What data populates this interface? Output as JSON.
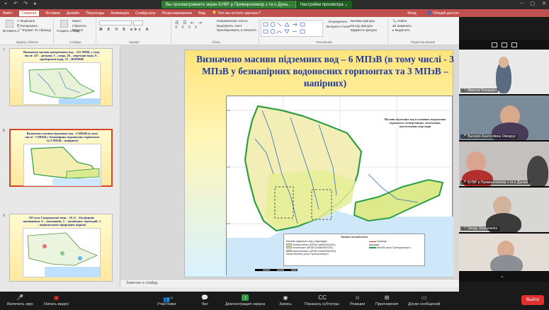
{
  "titlebar": {
    "share_message": "Вы просматриваете экран БУВР р.Приморономор з та є-Дуна...",
    "view_options": "Настройки просмотра"
  },
  "ribbon": {
    "tabs": [
      "Файл",
      "Главная",
      "Вставка",
      "Дизайн",
      "Переходы",
      "Анимация",
      "Слайд-шоу",
      "Рецензирование",
      "Вид",
      "Что вы хотите сделать?"
    ],
    "right": [
      "Вход",
      "Общий доступ"
    ],
    "clipboard": {
      "paste": "Вставить",
      "cut": "Вырезать",
      "copy": "Копировать",
      "format_painter": "Формат по образцу",
      "group": "Буфер обмена"
    },
    "slides": {
      "new_slide": "Создать слайд",
      "layout": "Макет",
      "reset": "Сбросить",
      "section": "Раздел",
      "group": "Слайды"
    },
    "font_group": "Шрифт",
    "paragraph": {
      "text_direction": "Направление текста",
      "align_text": "Выровнять текст",
      "smartart": "Преобразовать в SmartArt",
      "group": "Абзац"
    },
    "drawing": {
      "arrange": "Упорядочить",
      "quick_styles": "Экспресс-стили",
      "fill": "Заливка фигуры",
      "outline": "Контур фигуры",
      "effects": "Эффекты фигуры",
      "group": "Рисование"
    },
    "editing": {
      "find": "Найти",
      "replace": "Заменить",
      "select": "Выделить",
      "group": "Редактирование"
    }
  },
  "thumbnails": [
    {
      "num": "7",
      "title": "Визначено масиви поверхневих вод – 231 МПВ, у тому числі: 227 – річкові, 3 – озера, 28 – перехідні води, 9 – прибережні води, 72 – ШЗМПВ"
    },
    {
      "num": "8",
      "title": "Визначено масиви підземних вод – 6 МПзВ (в тому числі - 3 МПзВ у безнапірних водоносних горизонтах та 3 МПзВ – напірних)"
    },
    {
      "num": "9",
      "title": "Об'єкти Спорадичної зони – 16 (2 – біосферних заповідника, 6 – заказників, 5 – заповідних територій, 3 – національних природних парків)"
    }
  ],
  "slide": {
    "title": "Визначено масиви підземних вод – 6 МПзВ (в тому числі - 3 МПзВ у безнапірних водоносних горизонтах та 3 МПзВ – напірних)",
    "map_title": "Масиви підземних вод в основних водоносних горизонтах четвертинних, неогенових, палеогенових відкладів",
    "legend": {
      "heading": "Умовні позначення",
      "items": [
        "Масиви підземних вод у відкладах:",
        "четвертинних (МПзВ UA6M9000400)",
        "неогенових (МПзВ UA6M9000200)",
        "палеогенових (МПзВ UA6M9000300)",
        "Межа басейну річок Причорномор'я",
        "Границя",
        "держави",
        "басейн річок Причорномор'я"
      ]
    }
  },
  "notes": {
    "placeholder": "Заметки к слайду"
  },
  "participants": [
    {
      "name": "Микола Бомашин",
      "muted": true
    },
    {
      "name": "Валерія Анатоліївна Овчарук",
      "muted": true
    },
    {
      "name": "БУВР р.Приморономор з та є-Дунаю",
      "muted": true
    },
    {
      "name": "Sergiy Stepanenko",
      "muted": true
    },
    {
      "name": "",
      "muted": false
    }
  ],
  "zoom_toolbar": {
    "mute": "Включить звук",
    "video": "Начать видео",
    "participants": "Участники",
    "participants_count": "11",
    "chat": "Чат",
    "share": "Демонстрация экрана",
    "record": "Запись",
    "captions": "Показать субтитры",
    "reactions": "Реакции",
    "apps": "Приложения",
    "whiteboards": "Доски сообщений",
    "leave": "Выйти"
  },
  "colors": {
    "ribbon": "#c0504d",
    "slide_title": "#1f3aa0",
    "share_green": "#2e7d32",
    "leave_red": "#e02f2f"
  }
}
